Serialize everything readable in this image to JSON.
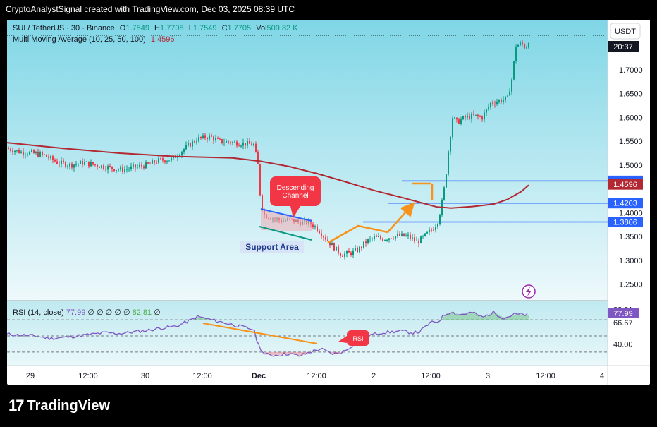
{
  "caption": "CryptoAnalystSignal created with TradingView.com, Dec 03, 2025 08:39 UTC",
  "brand": "TradingView",
  "legend": {
    "symbol": "SUI / TetherUS · 30 · Binance",
    "open_label": "O",
    "open": "1.7549",
    "high_label": "H",
    "high": "1.7708",
    "low_label": "L",
    "low": "1.7549",
    "close_label": "C",
    "close": "1.7705",
    "vol_label": "Vol",
    "vol": "509.82 K",
    "ma_label": "Multi Moving Average (10, 25, 50, 100)",
    "ma_value": "1.4596"
  },
  "rsi_legend": {
    "label": "RSI (14, close)",
    "value": "77.99",
    "zeros": "∅ ∅ ∅ ∅ ∅",
    "value2": "82.81",
    "zero_end": "∅"
  },
  "currency_button": "USDT",
  "price_axis_ticks": [
    "1.7000",
    "1.6500",
    "1.6000",
    "1.5500",
    "1.5000",
    "1.4000",
    "1.3500",
    "1.3000",
    "1.2500"
  ],
  "price_badges": [
    {
      "text": "1.4667",
      "color": "#2962ff"
    },
    {
      "text": "1.4596",
      "color": "#b22833"
    },
    {
      "text": "1.4203",
      "color": "#2962ff"
    },
    {
      "text": "1.3806",
      "color": "#2962ff"
    }
  ],
  "time_badge": "20:37",
  "rsi_axis_ticks": [
    "82.81",
    "77.99",
    "66.67",
    "40.00"
  ],
  "time_axis": [
    "29",
    "12:00",
    "30",
    "12:00",
    "Dec",
    "12:00",
    "2",
    "12:00",
    "3",
    "12:00",
    "4"
  ],
  "annotations": {
    "descending_channel": [
      "Descending",
      "Channel"
    ],
    "support_area": "Support Area",
    "rsi_tag": "RSI"
  },
  "colors": {
    "bull": "#089981",
    "bear": "#f23645",
    "ma": "#b22833",
    "level": "#2962ff",
    "arrow": "#f7931a",
    "rsi": "#7e57c2",
    "bg_top": "#7fd6e6",
    "bg_bottom": "#eef9fb"
  },
  "chart_data": {
    "type": "candlestick",
    "ylim": [
      1.22,
      1.79
    ],
    "levels": [
      1.4667,
      1.4203,
      1.3806
    ],
    "price_path": [
      [
        0,
        1.535
      ],
      [
        18,
        1.528
      ],
      [
        36,
        1.525
      ],
      [
        54,
        1.52
      ],
      [
        72,
        1.505
      ],
      [
        90,
        1.5
      ],
      [
        108,
        1.505
      ],
      [
        126,
        1.5
      ],
      [
        144,
        1.495
      ],
      [
        162,
        1.49
      ],
      [
        180,
        1.495
      ],
      [
        198,
        1.5
      ],
      [
        216,
        1.51
      ],
      [
        234,
        1.512
      ],
      [
        252,
        1.535
      ],
      [
        270,
        1.555
      ],
      [
        288,
        1.56
      ],
      [
        300,
        1.55
      ],
      [
        318,
        1.548
      ],
      [
        336,
        1.545
      ],
      [
        350,
        1.543
      ],
      [
        356,
        1.5
      ],
      [
        360,
        1.42
      ],
      [
        365,
        1.395
      ],
      [
        378,
        1.388
      ],
      [
        390,
        1.383
      ],
      [
        402,
        1.385
      ],
      [
        414,
        1.38
      ],
      [
        426,
        1.38
      ],
      [
        438,
        1.37
      ],
      [
        450,
        1.35
      ],
      [
        462,
        1.33
      ],
      [
        474,
        1.312
      ],
      [
        486,
        1.315
      ],
      [
        498,
        1.322
      ],
      [
        510,
        1.34
      ],
      [
        522,
        1.348
      ],
      [
        534,
        1.345
      ],
      [
        546,
        1.35
      ],
      [
        558,
        1.352
      ],
      [
        570,
        1.35
      ],
      [
        582,
        1.338
      ],
      [
        594,
        1.353
      ],
      [
        606,
        1.37
      ],
      [
        612,
        1.385
      ],
      [
        618,
        1.43
      ],
      [
        622,
        1.47
      ],
      [
        626,
        1.53
      ],
      [
        632,
        1.6
      ],
      [
        638,
        1.59
      ],
      [
        650,
        1.6
      ],
      [
        662,
        1.603
      ],
      [
        674,
        1.6
      ],
      [
        686,
        1.63
      ],
      [
        698,
        1.635
      ],
      [
        710,
        1.64
      ],
      [
        716,
        1.68
      ],
      [
        722,
        1.75
      ],
      [
        730,
        1.755
      ],
      [
        736,
        1.745
      ],
      [
        742,
        1.77
      ]
    ],
    "ma_path": [
      [
        0,
        1.547
      ],
      [
        80,
        1.535
      ],
      [
        160,
        1.525
      ],
      [
        240,
        1.518
      ],
      [
        320,
        1.515
      ],
      [
        360,
        1.508
      ],
      [
        400,
        1.497
      ],
      [
        440,
        1.482
      ],
      [
        480,
        1.465
      ],
      [
        520,
        1.447
      ],
      [
        560,
        1.432
      ],
      [
        590,
        1.42
      ],
      [
        610,
        1.412
      ],
      [
        630,
        1.41
      ],
      [
        660,
        1.413
      ],
      [
        690,
        1.418
      ],
      [
        710,
        1.428
      ],
      [
        730,
        1.445
      ],
      [
        740,
        1.458
      ]
    ],
    "rsi": {
      "ylim": [
        15,
        92
      ],
      "levels": [
        70,
        50,
        30
      ],
      "path": [
        [
          0,
          52
        ],
        [
          20,
          51
        ],
        [
          40,
          50
        ],
        [
          60,
          47
        ],
        [
          80,
          48
        ],
        [
          100,
          50
        ],
        [
          120,
          52
        ],
        [
          140,
          54
        ],
        [
          160,
          53
        ],
        [
          180,
          55
        ],
        [
          200,
          57
        ],
        [
          220,
          60
        ],
        [
          240,
          62
        ],
        [
          262,
          70
        ],
        [
          270,
          74
        ],
        [
          280,
          72
        ],
        [
          300,
          68
        ],
        [
          320,
          64
        ],
        [
          340,
          60
        ],
        [
          350,
          58
        ],
        [
          356,
          40
        ],
        [
          365,
          27
        ],
        [
          380,
          26
        ],
        [
          400,
          28
        ],
        [
          415,
          25
        ],
        [
          430,
          30
        ],
        [
          445,
          34
        ],
        [
          460,
          28
        ],
        [
          470,
          28
        ],
        [
          480,
          32
        ],
        [
          500,
          45
        ],
        [
          515,
          51
        ],
        [
          530,
          54
        ],
        [
          545,
          55
        ],
        [
          560,
          56
        ],
        [
          575,
          54
        ],
        [
          585,
          55
        ],
        [
          600,
          66
        ],
        [
          612,
          68
        ],
        [
          620,
          76
        ],
        [
          630,
          80
        ],
        [
          640,
          76
        ],
        [
          660,
          79
        ],
        [
          675,
          73
        ],
        [
          690,
          79
        ],
        [
          705,
          72
        ],
        [
          720,
          77
        ],
        [
          738,
          76
        ]
      ]
    }
  }
}
